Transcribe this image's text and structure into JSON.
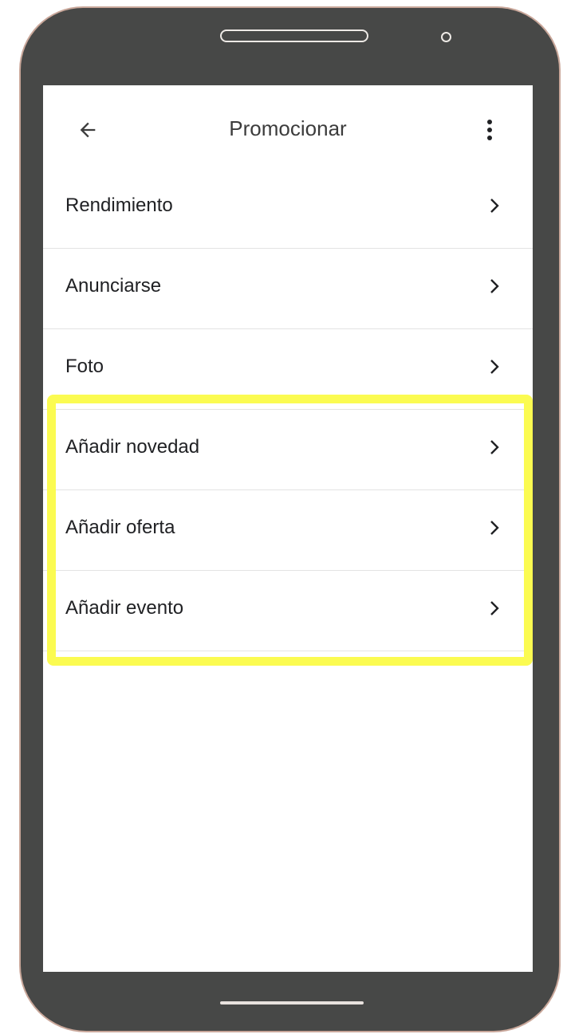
{
  "app": {
    "title": "Promocionar"
  },
  "icons": {
    "back": "arrow-back-icon",
    "more": "more-vert-icon",
    "chevron": "chevron-right-icon"
  },
  "menu": {
    "items": [
      {
        "label": "Rendimiento"
      },
      {
        "label": "Anunciarse"
      },
      {
        "label": "Foto"
      },
      {
        "label": "Añadir novedad"
      },
      {
        "label": "Añadir oferta"
      },
      {
        "label": "Añadir evento"
      }
    ]
  },
  "colors": {
    "highlight": "#fbfb51",
    "device_frame": "#474847",
    "text": "#202124"
  }
}
